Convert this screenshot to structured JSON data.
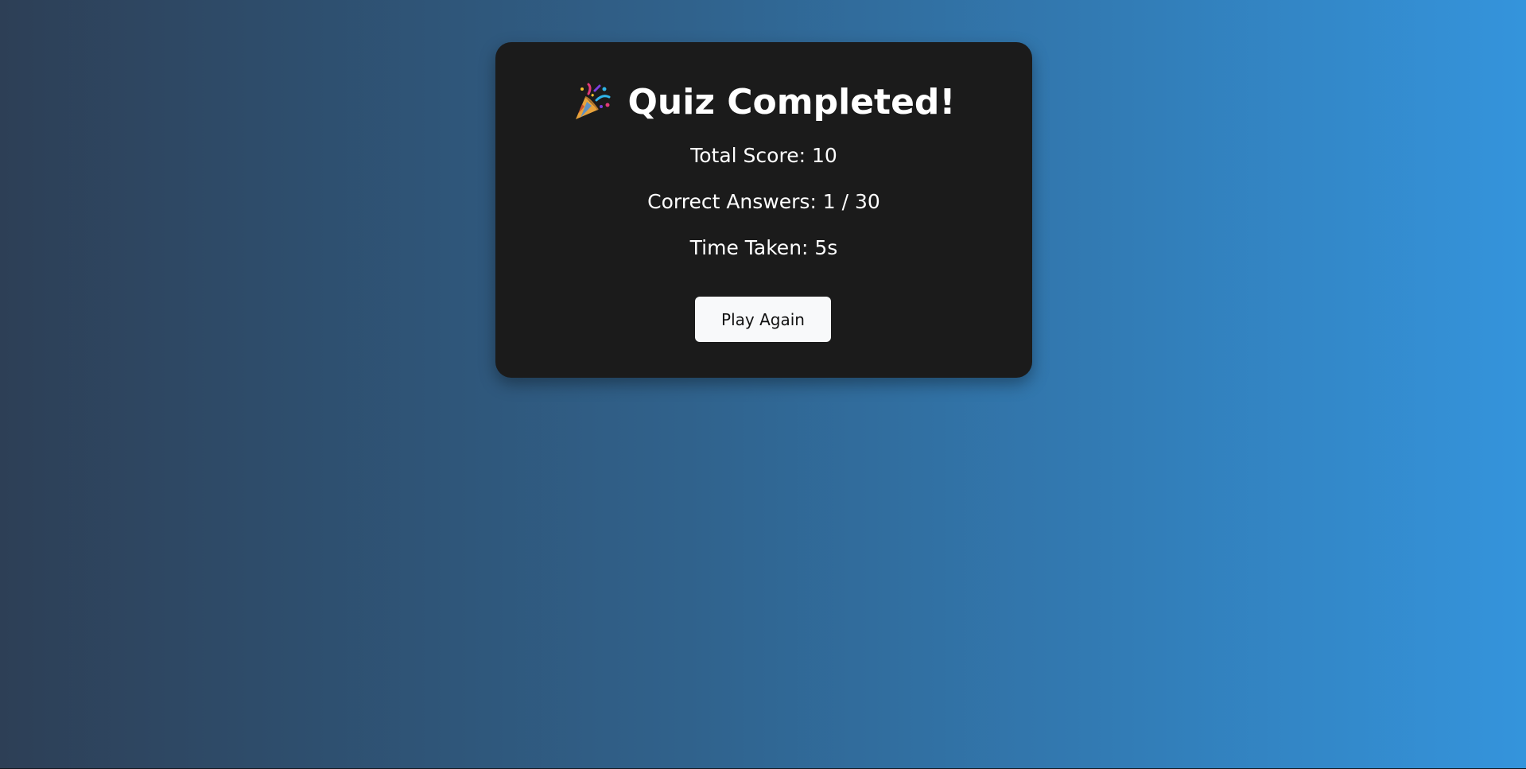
{
  "results": {
    "title": "Quiz Completed!",
    "title_icon": "party-popper-icon",
    "score_text": "Total Score: 10",
    "correct_text": "Correct Answers: 1 / 30",
    "time_text": "Time Taken: 5s",
    "play_again_label": "Play Again"
  },
  "colors": {
    "card_background": "#1b1b1b",
    "background_gradient_start": "#2d3f56",
    "background_gradient_end": "#3494dc",
    "button_background": "#f8f9fa"
  }
}
